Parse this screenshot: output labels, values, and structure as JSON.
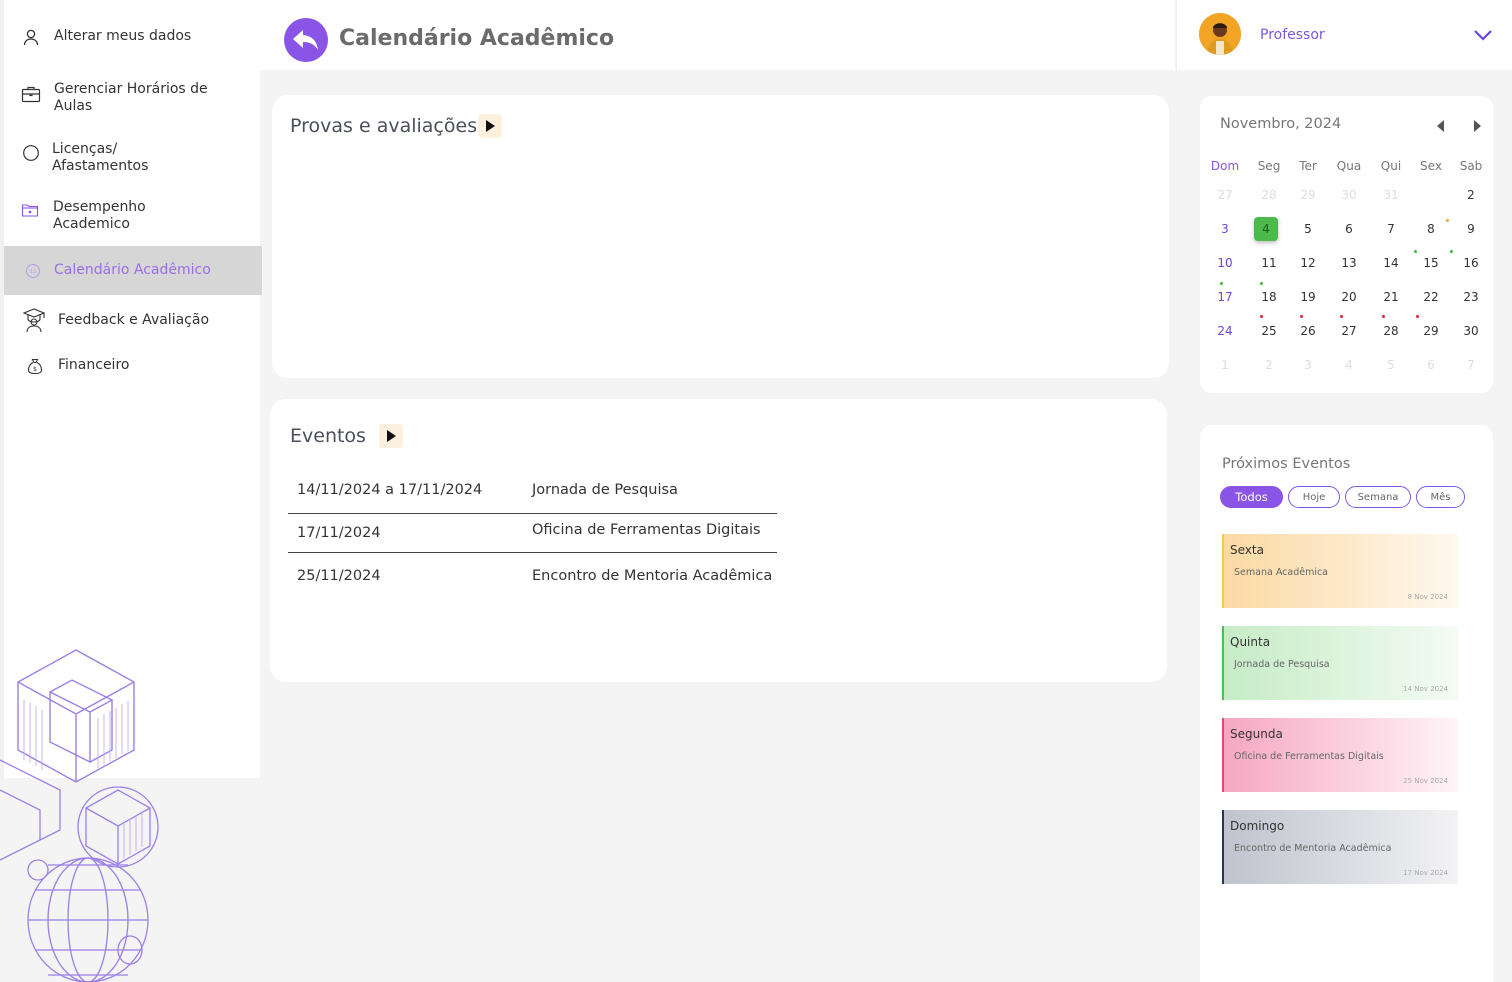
{
  "sidebar": {
    "items": [
      {
        "label": "Alterar meus dados",
        "icon": "user-icon"
      },
      {
        "label": "Gerenciar Horários de\nAulas",
        "icon": "briefcase-icon"
      },
      {
        "label": "Licenças/\nAfastamentos",
        "icon": "circle-icon"
      },
      {
        "label": "Desempenho\nAcademico",
        "icon": "folder-icon"
      },
      {
        "label": "Calendário Acadêmico",
        "icon": "calendar-badge-icon"
      },
      {
        "label": "Feedback e Avaliação",
        "icon": "graduate-icon"
      },
      {
        "label": "Financeiro",
        "icon": "money-bag-icon"
      }
    ]
  },
  "header": {
    "title": "Calendário Acadêmico"
  },
  "profile": {
    "name": "Professor"
  },
  "provas": {
    "title": "Provas e  avaliações"
  },
  "eventos": {
    "title": "Eventos",
    "rows": [
      {
        "date": "14/11/2024 a 17/11/2024",
        "name": "Jornada de Pesquisa"
      },
      {
        "date": "17/11/2024",
        "name": "Oficina de Ferramentas Digitais"
      },
      {
        "date": "25/11/2024",
        "name": "Encontro de Mentoria Acadêmica"
      }
    ]
  },
  "calendar": {
    "title": "Novembro, 2024",
    "weekdays": [
      "Dom",
      "Seg",
      "Ter",
      "Qua",
      "Qui",
      "Sex",
      "Sab"
    ],
    "weeks": [
      [
        "27",
        "28",
        "29",
        "30",
        "31",
        "",
        "2"
      ],
      [
        "3",
        "4",
        "5",
        "6",
        "7",
        "8",
        "9"
      ],
      [
        "10",
        "11",
        "12",
        "13",
        "14",
        "15",
        "16"
      ],
      [
        "17",
        "18",
        "19",
        "20",
        "21",
        "22",
        "23"
      ],
      [
        "24",
        "25",
        "26",
        "27",
        "28",
        "29",
        "30"
      ],
      [
        "1",
        "2",
        "3",
        "4",
        "5",
        "6",
        "7"
      ]
    ],
    "today": "4"
  },
  "upcoming": {
    "title": "Próximos Eventos",
    "filters": [
      "Todos",
      "Hoje",
      "Semana",
      "Mês"
    ],
    "events": [
      {
        "day": "Sexta",
        "name": "Semana Acadêmica",
        "date": "8 Nov 2024",
        "color": "#f5c842"
      },
      {
        "day": "Quinta",
        "name": "Jornada de Pesquisa",
        "date": "14 Nov  2024",
        "color": "#4cc24c"
      },
      {
        "day": "Segunda",
        "name": "Oficina de Ferramentas Digitais",
        "date": "25 Nov 2024",
        "color": "#e8457a"
      },
      {
        "day": "Domingo",
        "name": "Encontro de Mentoria Acadêmica",
        "date": "17 Nov 2024",
        "color": "#2c3355"
      }
    ]
  },
  "colors": {
    "accent": "#8a55e6",
    "active_bg": "#d6d6d6"
  }
}
